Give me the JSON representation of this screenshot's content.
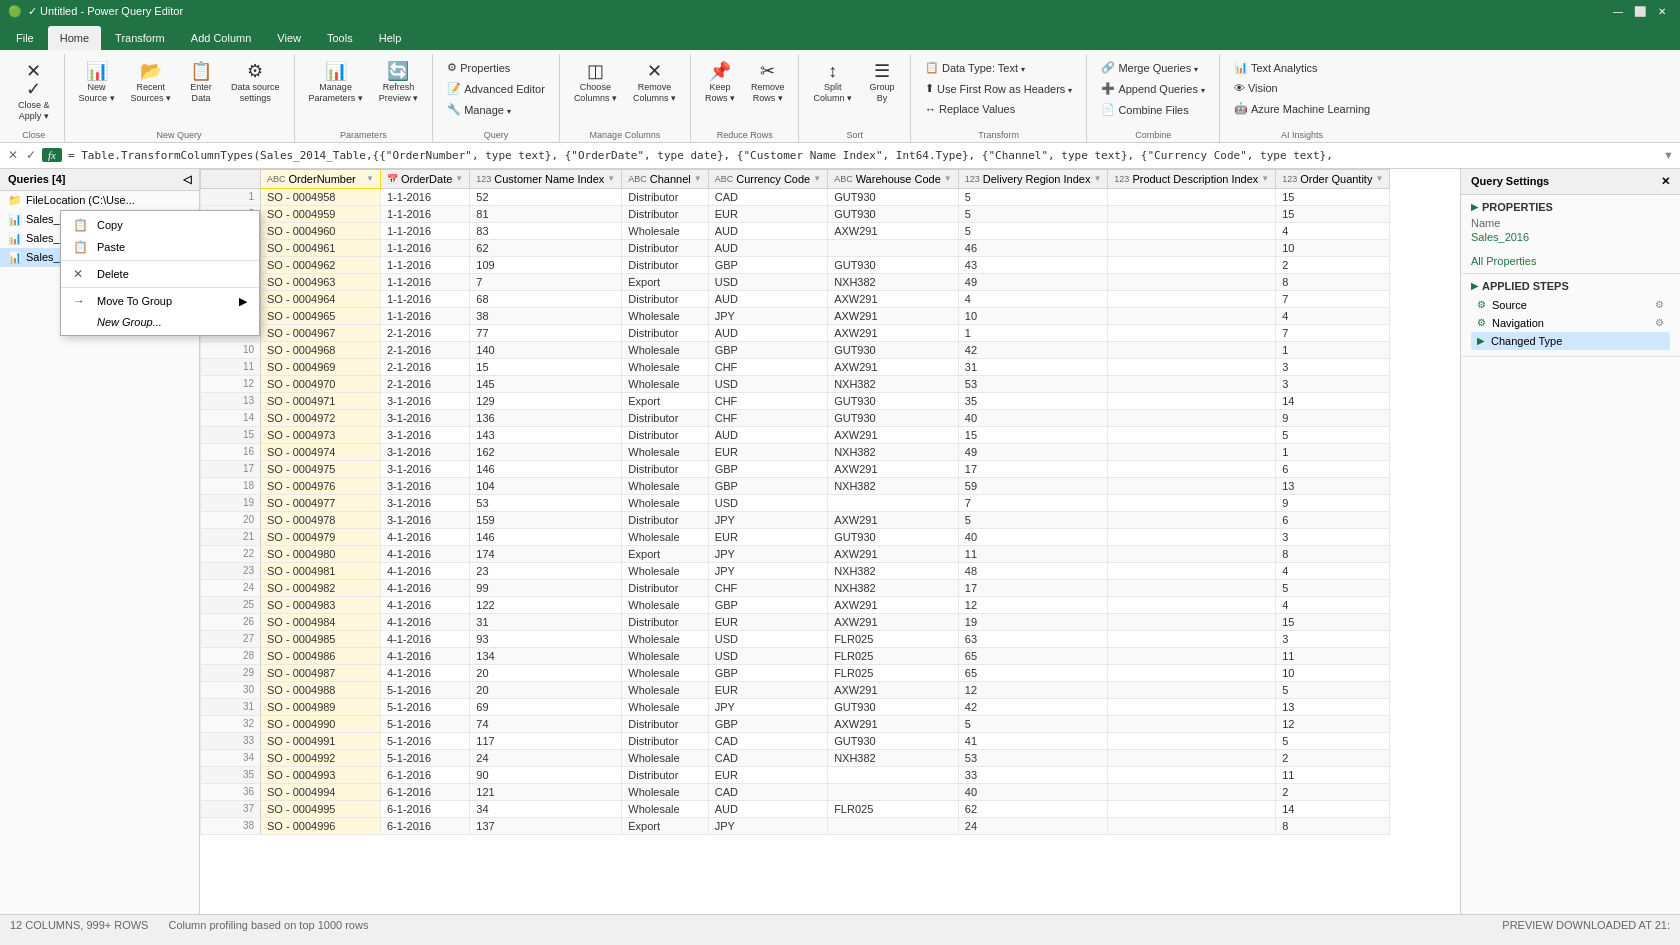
{
  "titleBar": {
    "title": "✓ Untitled - Power Query Editor",
    "icons": [
      "🔒",
      "💾",
      "↩"
    ],
    "controls": [
      "—",
      "⬜",
      "✕"
    ]
  },
  "menuBar": {
    "items": [
      "File",
      "Home",
      "Transform",
      "Add Column",
      "View",
      "Tools",
      "Help"
    ]
  },
  "ribbon": {
    "tabs": [
      "File",
      "Home",
      "Transform",
      "Add Column",
      "View",
      "Tools",
      "Help"
    ],
    "activeTab": "Home",
    "groups": [
      {
        "name": "Close",
        "buttons": [
          {
            "icon": "✕",
            "label": "Close &\nApply",
            "dropdown": true
          }
        ]
      },
      {
        "name": "New Query",
        "buttons": [
          {
            "icon": "📋",
            "label": "New\nSource",
            "dropdown": true
          },
          {
            "icon": "📂",
            "label": "Recent\nSources",
            "dropdown": true
          },
          {
            "icon": "⬆",
            "label": "Enter\nData"
          },
          {
            "icon": "⚙",
            "label": "Data source\nsettings"
          }
        ]
      },
      {
        "name": "Parameters",
        "buttons": [
          {
            "icon": "📊",
            "label": "Manage\nParameters",
            "dropdown": true
          },
          {
            "icon": "🔄",
            "label": "Refresh\nPreview",
            "dropdown": true
          }
        ]
      },
      {
        "name": "Query",
        "buttons": [
          {
            "icon": "⚙",
            "label": "Properties"
          },
          {
            "icon": "📝",
            "label": "Advanced Editor"
          },
          {
            "icon": "🔧",
            "label": "Manage ▾"
          }
        ]
      },
      {
        "name": "Manage Columns",
        "buttons": [
          {
            "icon": "◫",
            "label": "Choose\nColumns",
            "dropdown": true
          },
          {
            "icon": "✕",
            "label": "Remove\nColumns",
            "dropdown": true
          }
        ]
      },
      {
        "name": "Reduce Rows",
        "buttons": [
          {
            "icon": "📌",
            "label": "Keep\nRows",
            "dropdown": true
          },
          {
            "icon": "✂",
            "label": "Remove\nRows",
            "dropdown": true
          }
        ]
      },
      {
        "name": "Sort",
        "buttons": [
          {
            "icon": "↕",
            "label": "Split\nColumn ▾"
          },
          {
            "icon": "☰",
            "label": "Group\nBy"
          }
        ]
      },
      {
        "name": "Transform",
        "buttons": [
          {
            "icon": "📋",
            "label": "Data Type: Text ▾"
          },
          {
            "icon": "⬆",
            "label": "Use First Row as Headers ▾"
          },
          {
            "icon": "↔",
            "label": "Replace Values"
          }
        ]
      },
      {
        "name": "Combine",
        "buttons": [
          {
            "icon": "🔗",
            "label": "Merge Queries ▾"
          },
          {
            "icon": "➕",
            "label": "Append Queries ▾"
          },
          {
            "icon": "📄",
            "label": "Combine Files"
          }
        ]
      },
      {
        "name": "AI Insights",
        "buttons": [
          {
            "icon": "📊",
            "label": "Text Analytics"
          },
          {
            "icon": "👁",
            "label": "Vision"
          },
          {
            "icon": "🤖",
            "label": "Azure Machine Learning"
          }
        ]
      }
    ]
  },
  "formulaBar": {
    "text": "= Table.TransformColumnTypes(Sales_2014_Table,{{\"OrderNumber\", type text}, {\"OrderDate\", type date}, {\"Customer Name Index\", Int64.Type}, {\"Channel\", type text}, {\"Currency Code\", type text},",
    "checkIcon": "✓",
    "xIcon": "✕",
    "fxLabel": "fx"
  },
  "queriesPanel": {
    "title": "Queries [4]",
    "items": [
      {
        "icon": "📁",
        "label": "FileLocation (C:\\Use...",
        "type": "folder"
      },
      {
        "icon": "📊",
        "label": "Sales_2014",
        "type": "table"
      },
      {
        "icon": "📊",
        "label": "Sales_2015",
        "type": "table"
      },
      {
        "icon": "📊",
        "label": "Sales_2016",
        "type": "table",
        "active": true
      }
    ]
  },
  "contextMenu": {
    "visible": true,
    "items": [
      {
        "label": "Copy",
        "icon": "📋"
      },
      {
        "label": "Paste",
        "icon": "📋"
      },
      {
        "label": "Delete",
        "icon": "✕"
      },
      {
        "label": "Move To Group",
        "icon": "→",
        "hasSubmenu": true
      },
      {
        "label": "New Group...",
        "indent": true
      }
    ]
  },
  "tableColumns": [
    {
      "label": "OrderNumber",
      "typeIcon": "ABC",
      "active": true
    },
    {
      "label": "OrderDate",
      "typeIcon": "📅"
    },
    {
      "label": "Customer Name Index",
      "typeIcon": "123"
    },
    {
      "label": "Channel",
      "typeIcon": "ABC"
    },
    {
      "label": "Currency Code",
      "typeIcon": "ABC"
    },
    {
      "label": "Warehouse Code",
      "typeIcon": "ABC"
    },
    {
      "label": "Delivery Region Index",
      "typeIcon": "123"
    },
    {
      "label": "Product Description Index",
      "typeIcon": "123"
    },
    {
      "label": "Order Quantity",
      "typeIcon": "123"
    }
  ],
  "tableRows": [
    [
      1,
      "SO - 0004958",
      "1-1-2016",
      52,
      "Distributor",
      "CAD",
      "GUT930",
      "",
      5,
      15
    ],
    [
      2,
      "SO - 0004959",
      "1-1-2016",
      81,
      "Distributor",
      "EUR",
      "GUT930",
      "",
      5,
      15
    ],
    [
      3,
      "SO - 0004960",
      "1-1-2016",
      83,
      "Wholesale",
      "AUD",
      "AXW291",
      "",
      5,
      4
    ],
    [
      4,
      "SO - 0004961",
      "1-1-2016",
      62,
      "Distributor",
      "AUD",
      "",
      "",
      46,
      10
    ],
    [
      5,
      "SO - 0004962",
      "1-1-2016",
      109,
      "Distributor",
      "GBP",
      "GUT930",
      "",
      43,
      2
    ],
    [
      6,
      "SO - 0004963",
      "1-1-2016",
      7,
      "Export",
      "USD",
      "NXH382",
      "",
      49,
      8
    ],
    [
      7,
      "SO - 0004964",
      "1-1-2016",
      68,
      "Distributor",
      "AUD",
      "AXW291",
      "",
      4,
      7
    ],
    [
      8,
      "SO - 0004965",
      "1-1-2016",
      38,
      "Wholesale",
      "JPY",
      "AXW291",
      "",
      10,
      4
    ],
    [
      9,
      "SO - 0004967",
      "2-1-2016",
      77,
      "Distributor",
      "AUD",
      "AXW291",
      "",
      1,
      7
    ],
    [
      10,
      "SO - 0004968",
      "2-1-2016",
      140,
      "Wholesale",
      "GBP",
      "GUT930",
      "",
      42,
      1
    ],
    [
      11,
      "SO - 0004969",
      "2-1-2016",
      15,
      "Wholesale",
      "CHF",
      "AXW291",
      "",
      31,
      3
    ],
    [
      12,
      "SO - 0004970",
      "2-1-2016",
      145,
      "Wholesale",
      "USD",
      "NXH382",
      "",
      53,
      3
    ],
    [
      13,
      "SO - 0004971",
      "3-1-2016",
      129,
      "Export",
      "CHF",
      "GUT930",
      "",
      35,
      14
    ],
    [
      14,
      "SO - 0004972",
      "3-1-2016",
      136,
      "Distributor",
      "CHF",
      "GUT930",
      "",
      40,
      9
    ],
    [
      15,
      "SO - 0004973",
      "3-1-2016",
      143,
      "Distributor",
      "AUD",
      "AXW291",
      "",
      15,
      5
    ],
    [
      16,
      "SO - 0004974",
      "3-1-2016",
      162,
      "Wholesale",
      "EUR",
      "NXH382",
      "",
      49,
      1
    ],
    [
      17,
      "SO - 0004975",
      "3-1-2016",
      146,
      "Distributor",
      "GBP",
      "AXW291",
      "",
      17,
      6
    ],
    [
      18,
      "SO - 0004976",
      "3-1-2016",
      104,
      "Wholesale",
      "GBP",
      "NXH382",
      "",
      59,
      13
    ],
    [
      19,
      "SO - 0004977",
      "3-1-2016",
      53,
      "Wholesale",
      "USD",
      "",
      "",
      7,
      9
    ],
    [
      20,
      "SO - 0004978",
      "3-1-2016",
      159,
      "Distributor",
      "JPY",
      "AXW291",
      "",
      5,
      6
    ],
    [
      21,
      "SO - 0004979",
      "4-1-2016",
      146,
      "Wholesale",
      "EUR",
      "GUT930",
      "",
      40,
      3
    ],
    [
      22,
      "SO - 0004980",
      "4-1-2016",
      174,
      "Export",
      "JPY",
      "AXW291",
      "",
      11,
      8
    ],
    [
      23,
      "SO - 0004981",
      "4-1-2016",
      23,
      "Wholesale",
      "JPY",
      "NXH382",
      "",
      48,
      4
    ],
    [
      24,
      "SO - 0004982",
      "4-1-2016",
      99,
      "Distributor",
      "CHF",
      "NXH382",
      "",
      17,
      5
    ],
    [
      25,
      "SO - 0004983",
      "4-1-2016",
      122,
      "Wholesale",
      "GBP",
      "AXW291",
      "",
      12,
      4
    ],
    [
      26,
      "SO - 0004984",
      "4-1-2016",
      31,
      "Distributor",
      "EUR",
      "AXW291",
      "",
      19,
      15
    ],
    [
      27,
      "SO - 0004985",
      "4-1-2016",
      93,
      "Wholesale",
      "USD",
      "FLR025",
      "",
      63,
      3
    ],
    [
      28,
      "SO - 0004986",
      "4-1-2016",
      134,
      "Wholesale",
      "USD",
      "FLR025",
      "",
      65,
      11
    ],
    [
      29,
      "SO - 0004987",
      "4-1-2016",
      20,
      "Wholesale",
      "GBP",
      "FLR025",
      "",
      65,
      10
    ],
    [
      30,
      "SO - 0004988",
      "5-1-2016",
      20,
      "Wholesale",
      "EUR",
      "AXW291",
      "",
      12,
      5
    ],
    [
      31,
      "SO - 0004989",
      "5-1-2016",
      69,
      "Wholesale",
      "JPY",
      "GUT930",
      "",
      42,
      13
    ],
    [
      32,
      "SO - 0004990",
      "5-1-2016",
      74,
      "Distributor",
      "GBP",
      "AXW291",
      "",
      5,
      12
    ],
    [
      33,
      "SO - 0004991",
      "5-1-2016",
      117,
      "Distributor",
      "CAD",
      "GUT930",
      "",
      41,
      5
    ],
    [
      34,
      "SO - 0004992",
      "5-1-2016",
      24,
      "Wholesale",
      "CAD",
      "NXH382",
      "",
      53,
      2
    ],
    [
      35,
      "SO - 0004993",
      "6-1-2016",
      90,
      "Distributor",
      "EUR",
      "",
      "",
      33,
      11
    ],
    [
      36,
      "SO - 0004994",
      "6-1-2016",
      121,
      "Wholesale",
      "CAD",
      "",
      "",
      40,
      2
    ],
    [
      37,
      "SO - 0004995",
      "6-1-2016",
      34,
      "Wholesale",
      "AUD",
      "FLR025",
      "",
      62,
      14
    ],
    [
      38,
      "SO - 0004996",
      "6-1-2016",
      137,
      "Export",
      "JPY",
      "",
      "",
      24,
      8
    ]
  ],
  "rightPanel": {
    "title": "Query Settings",
    "sections": [
      {
        "title": "PROPERTIES",
        "items": [
          {
            "label": "Name",
            "value": "Sales_2016"
          },
          {
            "label": "",
            "value": "All Properties"
          }
        ]
      },
      {
        "title": "APPLIED STEPS",
        "steps": [
          {
            "label": "Source",
            "hasGear": true
          },
          {
            "label": "Navigation",
            "hasGear": true
          },
          {
            "label": "Changed Type",
            "active": true,
            "hasGear": false
          }
        ]
      }
    ]
  },
  "statusBar": {
    "rowsInfo": "12 COLUMNS, 999+ ROWS",
    "profileInfo": "Column profiling based on top 1000 rows",
    "previewInfo": "PREVIEW DOWNLOADED AT 21:"
  }
}
